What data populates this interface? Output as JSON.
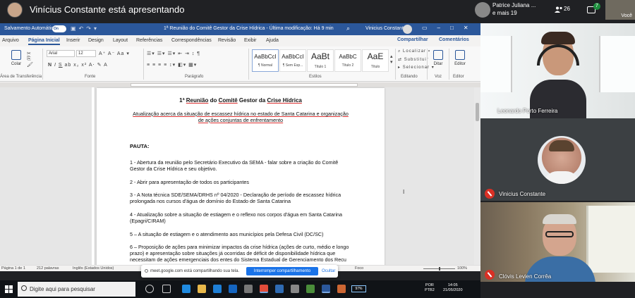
{
  "meet": {
    "presenting_text": "Vinícius Constante está apresentando",
    "participants_label_line1": "Patrice Juliana ...",
    "participants_label_line2": "e mais 19",
    "people_count": "26",
    "chat_badge": "7",
    "self_label": "Você"
  },
  "word": {
    "autosave_label": "Salvamento Automático",
    "autosave_state": "On",
    "doc_title": "1ª Reunião do Comitê Gestor da Crise Hídrica  -  Última modificação: Há 9 min",
    "user_name": "Vinicius Constante",
    "tabs": [
      "Arquivo",
      "Página Inicial",
      "Inserir",
      "Design",
      "Layout",
      "Referências",
      "Correspondências",
      "Revisão",
      "Exibir",
      "Ajuda"
    ],
    "share_label": "Compartilhar",
    "comments_label": "Comentários",
    "font_name": "Arial",
    "font_size": "12",
    "paste_label": "Colar",
    "clipboard_group": "Área de Transferência",
    "font_group": "Fonte",
    "paragraph_group": "Parágrafo",
    "styles_group": "Estilos",
    "editing_group": "Editando",
    "voice_group": "Voz",
    "editor_group": "Editor",
    "styles": [
      {
        "sample": "AaBbCcI",
        "name": "¶ Normal"
      },
      {
        "sample": "AaBbCcI",
        "name": "¶ Sem Esp..."
      },
      {
        "sample": "AaBt",
        "name": "Título 1"
      },
      {
        "sample": "AaBbC",
        "name": "Título 2"
      },
      {
        "sample": "AaE",
        "name": "Título"
      }
    ],
    "find_label": "Localizar",
    "replace_label": "Substituir",
    "select_label": "Selecionar",
    "dictate_label": "Ditar",
    "editor_label": "Editor",
    "status": {
      "page": "Página 1 de 1",
      "words": "212 palavras",
      "language": "Inglês (Estados Unidos)",
      "focus": "Foco",
      "zoom": "100%"
    }
  },
  "document": {
    "title_prefix": "1ª ",
    "title_u1": "Reunião",
    "title_mid1": " do ",
    "title_u2": "Comitê",
    "title_mid2": " Gestor da ",
    "title_u3": "Crise Hídrica",
    "subtitle_line1": "Atualização acerca da situação de escassez hídrica no estado de Santa Catarina e organização",
    "subtitle_line2": "de ações conjuntas de enfrentamento",
    "pauta": "PAUTA:",
    "items": [
      "1 - Abertura da reunião pelo Secretário Executivo da SEMA - falar sobre a criação do Comitê Gestor da Crise Hídrica e seu objetivo.",
      "2 - Abrir para apresentação de todos os participantes",
      "3 - A Nota técnica SDE/SEMA/DRHS nº 04/2020 - Declaração de período de escassez hídrica prolongada nos cursos d'água de domínio do Estado de Santa Catarina",
      "4 - Atualização sobre a situação de estiagem e o reflexo nos corpos d'água em Santa Catarina (Epagri/CIRAM)",
      "5 – A situação de estiagem e o atendimento aos municípios pela Defesa Civil (DC/SC)",
      "6 – Proposição de ações para minimizar impactos da crise hídrica (ações de curto, médio e longo prazo) e apresentação sobre situações já ocorridas de déficit de disponibilidade hídrica que necessitam de ações emergenciais dos entes do Sistema Estadual de Gerenciamento dos Recu"
    ]
  },
  "banner": {
    "message": "meet.google.com está compartilhando sua tela.",
    "stop_label": "Interromper compartilhamento",
    "hide_label": "Ocultar"
  },
  "taskbar": {
    "search_placeholder": "Digite aqui para pesquisar",
    "battery": "97%",
    "lang_line1": "POR",
    "lang_line2": "PTB2",
    "time": "14:05",
    "date": "21/05/2020"
  },
  "tiles": [
    {
      "name": "Leonardo Porto Ferreira"
    },
    {
      "name": "Vinicius Constante"
    },
    {
      "name": "Clóvis Levien Corrêa"
    }
  ]
}
